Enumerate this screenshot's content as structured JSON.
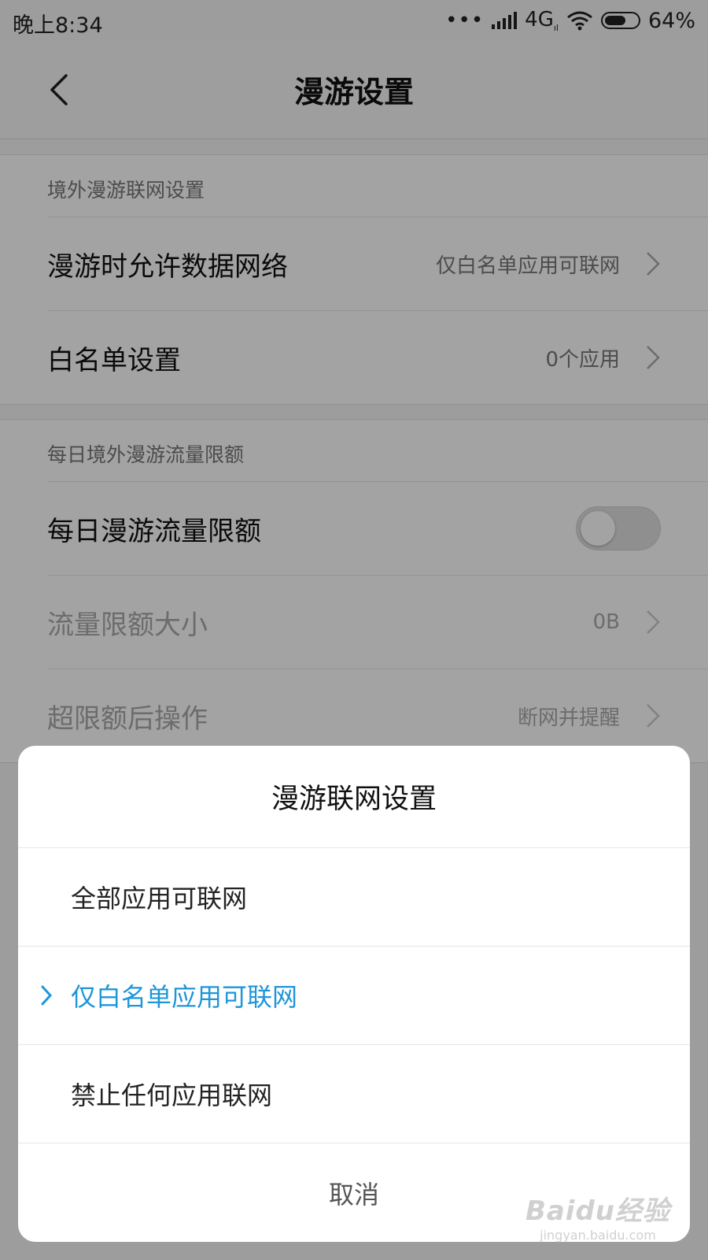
{
  "status_bar": {
    "time": "晚上8:34",
    "dots": "•••",
    "network": "4G",
    "network_sub": "ıl",
    "battery": "64%",
    "battery_level": 0.64
  },
  "header": {
    "title": "漫游设置"
  },
  "groups": [
    {
      "header": "境外漫游联网设置",
      "rows": [
        {
          "label": "漫游时允许数据网络",
          "value": "仅白名单应用可联网"
        },
        {
          "label": "白名单设置",
          "value": "0个应用"
        }
      ]
    },
    {
      "header": "每日境外漫游流量限额",
      "rows": [
        {
          "label": "每日漫游流量限额",
          "toggle": false
        },
        {
          "label": "流量限额大小",
          "value": "0B",
          "disabled": true
        },
        {
          "label": "超限额后操作",
          "value": "断网并提醒",
          "disabled": true
        }
      ]
    }
  ],
  "dialog": {
    "title": "漫游联网设置",
    "options": [
      {
        "label": "全部应用可联网",
        "selected": false
      },
      {
        "label": "仅白名单应用可联网",
        "selected": true
      },
      {
        "label": "禁止任何应用联网",
        "selected": false
      }
    ],
    "cancel_label": "取消"
  },
  "watermark": {
    "main": "Baidu经验",
    "sub": "jingyan.baidu.com"
  },
  "colors": {
    "accent": "#1e96d8",
    "overlay": "rgba(0,0,0,0.36)"
  }
}
